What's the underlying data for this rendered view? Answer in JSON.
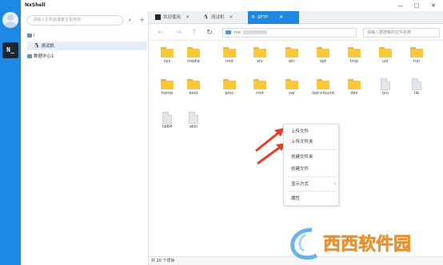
{
  "app": {
    "title": "NxShell"
  },
  "window": {
    "minimize": "—",
    "maximize": "□",
    "close": "✕"
  },
  "sidebar": {
    "search_placeholder": "请输入主机名或者主机地址",
    "tree": [
      {
        "label": "l",
        "indent": 0
      },
      {
        "label": "测试机",
        "indent": 1
      },
      {
        "label": "数据中心1",
        "indent": 0
      }
    ]
  },
  "tabs": [
    {
      "label": "欢迎使用",
      "active": false
    },
    {
      "label": "测试机",
      "active": false
    },
    {
      "label": "SFTP",
      "active": true
    }
  ],
  "toolbar": {
    "path_prefix": "roo",
    "search_placeholder": "请输入要搜索的文件名称"
  },
  "files": [
    {
      "name": "sys",
      "type": "folder"
    },
    {
      "name": "media",
      "type": "folder"
    },
    {
      "name": "root",
      "type": "folder"
    },
    {
      "name": "srv",
      "type": "folder"
    },
    {
      "name": "etc",
      "type": "folder"
    },
    {
      "name": "opt",
      "type": "folder"
    },
    {
      "name": "tmp",
      "type": "folder"
    },
    {
      "name": "usr",
      "type": "folder"
    },
    {
      "name": "run",
      "type": "folder"
    },
    {
      "name": "home",
      "type": "folder"
    },
    {
      "name": "boot",
      "type": "folder"
    },
    {
      "name": "proc",
      "type": "folder"
    },
    {
      "name": "mnt",
      "type": "folder"
    },
    {
      "name": "var",
      "type": "folder"
    },
    {
      "name": "lost+found",
      "type": "folder"
    },
    {
      "name": "dev",
      "type": "folder"
    },
    {
      "name": "bin",
      "type": "file"
    },
    {
      "name": "lib",
      "type": "file"
    },
    {
      "name": "lib64",
      "type": "file"
    },
    {
      "name": "sbin",
      "type": "file"
    }
  ],
  "context_menu": {
    "upload_file": "上传文件",
    "upload_folder": "上传文件夹",
    "new_folder": "创建文件夹",
    "new_file": "创建文件",
    "display_mode": "显示方式",
    "properties": "属性"
  },
  "status": {
    "text": "共 20 个项目"
  },
  "watermark": {
    "text": "西西软件园"
  },
  "colors": {
    "accent": "#1e88e5",
    "folder": "#fcc737",
    "arrow": "#e0402a"
  }
}
